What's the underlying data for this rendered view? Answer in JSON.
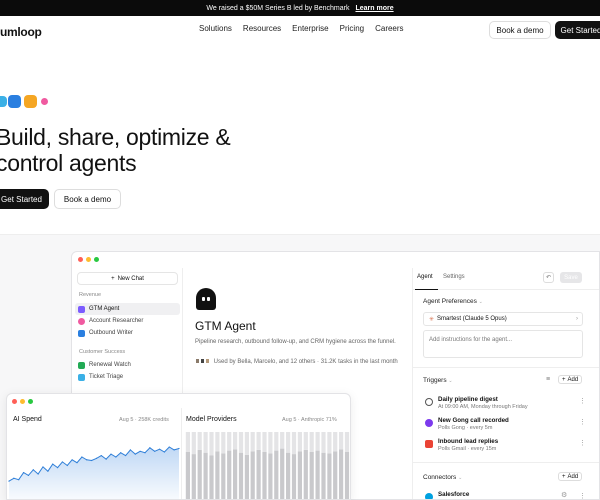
{
  "announcement": {
    "text": "We raised a $50M Series B led by Benchmark",
    "link": "Learn more"
  },
  "nav": {
    "logo": "umloop",
    "menu": [
      "Solutions",
      "Resources",
      "Enterprise",
      "Pricing",
      "Careers"
    ],
    "book_demo": "Book a demo",
    "get_started": "Get Started"
  },
  "hero": {
    "title_line1": "Build, share, optimize &",
    "title_line2": "control agents",
    "get_started": "Get Started",
    "book_demo": "Book a demo",
    "squares": [
      "#3bb0e6",
      "#2a7fe0",
      "#f5a623",
      "#f05aa0"
    ]
  },
  "app": {
    "sidebar": {
      "new_chat": "New Chat",
      "groups": [
        {
          "label": "Revenue",
          "items": [
            {
              "label": "GTM Agent",
              "color": "#7c5cff",
              "active": true
            },
            {
              "label": "Account Researcher",
              "color": "#f05aa0",
              "active": false
            },
            {
              "label": "Outbound Writer",
              "color": "#2a7fe0",
              "active": false
            }
          ]
        },
        {
          "label": "Customer Success",
          "items": [
            {
              "label": "Renewal Watch",
              "color": "#22aa55",
              "active": false
            },
            {
              "label": "Ticket Triage",
              "color": "#3bb0e6",
              "active": false
            }
          ]
        }
      ]
    },
    "agent": {
      "title": "GTM Agent",
      "description": "Pipeline research, outbound follow-up, and CRM hygiene across the funnel.",
      "usage": "Used by Bella, Marcelo, and 12 others · 31.2K tasks in the last month"
    },
    "panel": {
      "tab_agent": "Agent",
      "tab_settings": "Settings",
      "save": "Save",
      "prefs_title": "Agent Preferences",
      "model": "Smartest (Claude 5 Opus)",
      "instructions_placeholder": "Add instructions for the agent...",
      "triggers_title": "Triggers",
      "add": "Add",
      "triggers": [
        {
          "name": "Daily pipeline digest",
          "sub": "At 09:00 AM, Monday through Friday",
          "color": "#555555"
        },
        {
          "name": "New Gong call recorded",
          "sub": "Polls Gong · every 5m",
          "color": "#7c3aed"
        },
        {
          "name": "Inbound lead replies",
          "sub": "Polls Gmail · every 15m",
          "color": "#ea4335"
        }
      ],
      "connectors_title": "Connectors",
      "connectors": [
        {
          "name": "Salesforce",
          "color": "#00a1e0"
        }
      ]
    }
  },
  "charts": {
    "ai_spend": {
      "title": "AI Spend",
      "meta": "Aug 5 · 258K credits"
    },
    "model_providers": {
      "title": "Model Providers",
      "meta": "Aug 5 · Anthropic 71%"
    }
  },
  "chart_data": [
    {
      "type": "area",
      "title": "AI Spend",
      "x": [
        1,
        2,
        3,
        4,
        5,
        6,
        7,
        8,
        9,
        10,
        11,
        12,
        13,
        14,
        15,
        16,
        17,
        18,
        19,
        20,
        21,
        22,
        23,
        24,
        25,
        26,
        27,
        28,
        29,
        30,
        31,
        32,
        33,
        34,
        35,
        36
      ],
      "values": [
        28,
        32,
        30,
        40,
        36,
        44,
        38,
        48,
        42,
        52,
        47,
        55,
        50,
        58,
        54,
        62,
        58,
        57,
        60,
        64,
        59,
        66,
        62,
        68,
        64,
        72,
        66,
        70,
        68,
        75,
        70,
        73,
        69,
        76,
        72,
        74
      ],
      "ylim": [
        0,
        100
      ]
    },
    {
      "type": "bar",
      "title": "Model Providers",
      "x": [
        1,
        2,
        3,
        4,
        5,
        6,
        7,
        8,
        9,
        10,
        11,
        12,
        13,
        14,
        15,
        16,
        17,
        18,
        19,
        20,
        21,
        22,
        23,
        24,
        25,
        26,
        27,
        28
      ],
      "series": [
        {
          "values": [
            0.71,
            0.68,
            0.74,
            0.7,
            0.66,
            0.72,
            0.69,
            0.73,
            0.75,
            0.7,
            0.67,
            0.72,
            0.74,
            0.71,
            0.69,
            0.73,
            0.76,
            0.7,
            0.68,
            0.72,
            0.74,
            0.71,
            0.73,
            0.7,
            0.69,
            0.72,
            0.75,
            0.71
          ]
        },
        {
          "values": [
            0.29,
            0.32,
            0.26,
            0.3,
            0.34,
            0.28,
            0.31,
            0.27,
            0.25,
            0.3,
            0.33,
            0.28,
            0.26,
            0.29,
            0.31,
            0.27,
            0.24,
            0.3,
            0.32,
            0.28,
            0.26,
            0.29,
            0.27,
            0.3,
            0.31,
            0.28,
            0.25,
            0.29
          ]
        }
      ],
      "ylim": [
        0,
        1
      ]
    }
  ]
}
